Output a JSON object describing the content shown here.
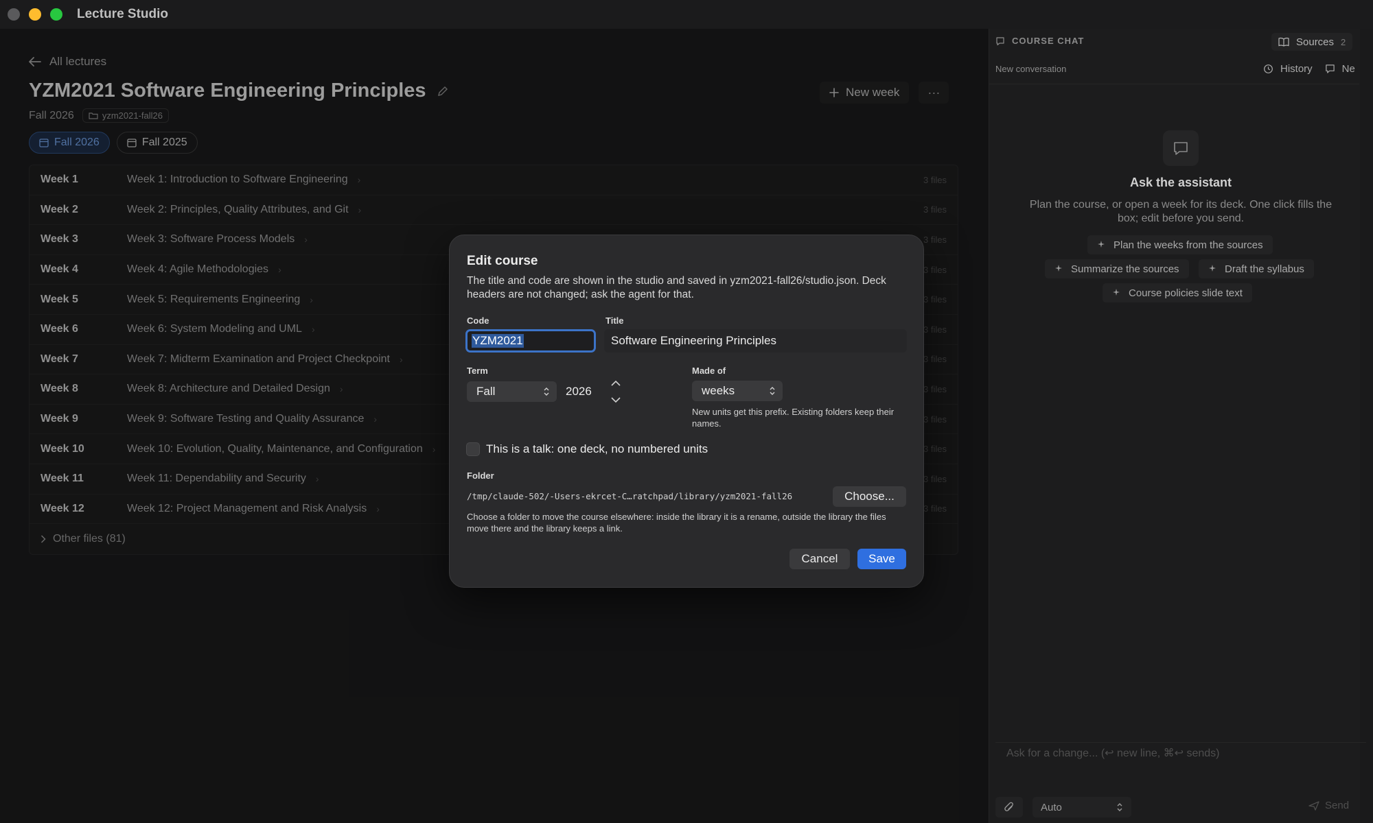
{
  "app": {
    "title": "Lecture Studio"
  },
  "window_controls": {
    "close_color": "#ff5f57",
    "minimize_color": "#febc2e",
    "zoom_color": "#28c840"
  },
  "header": {
    "back_label": "All lectures",
    "course_title": "YZM2021 Software Engineering Principles",
    "term": "Fall 2026",
    "folder": "yzm2021-fall26",
    "new_week_label": "New week",
    "more_label": "···"
  },
  "term_tabs": [
    {
      "label": "Fall 2026",
      "active": true
    },
    {
      "label": "Fall 2025",
      "active": false
    }
  ],
  "weeks": [
    {
      "num": "Week 1",
      "title": "Week 1: Introduction to Software Engineering",
      "files": "3 files"
    },
    {
      "num": "Week 2",
      "title": "Week 2: Principles, Quality Attributes, and Git",
      "files": "3 files"
    },
    {
      "num": "Week 3",
      "title": "Week 3: Software Process Models",
      "files": "3 files"
    },
    {
      "num": "Week 4",
      "title": "Week 4: Agile Methodologies",
      "files": "3 files"
    },
    {
      "num": "Week 5",
      "title": "Week 5: Requirements Engineering",
      "files": "3 files"
    },
    {
      "num": "Week 6",
      "title": "Week 6: System Modeling and UML",
      "files": "3 files"
    },
    {
      "num": "Week 7",
      "title": "Week 7: Midterm Examination and Project Checkpoint",
      "files": "3 files"
    },
    {
      "num": "Week 8",
      "title": "Week 8: Architecture and Detailed Design",
      "files": "3 files"
    },
    {
      "num": "Week 9",
      "title": "Week 9: Software Testing and Quality Assurance",
      "files": "3 files"
    },
    {
      "num": "Week 10",
      "title": "Week 10: Evolution, Quality, Maintenance, and Configuration",
      "files": "3 files"
    },
    {
      "num": "Week 11",
      "title": "Week 11: Dependability and Security",
      "files": "3 files"
    },
    {
      "num": "Week 12",
      "title": "Week 12: Project Management and Risk Analysis",
      "files": "3 files"
    }
  ],
  "other_files": "Other files (81)",
  "chat": {
    "header": "COURSE CHAT",
    "sources_label": "Sources",
    "sources_count": "2",
    "new_conversation": "New conversation",
    "history_label": "History",
    "new_label": "Ne",
    "assistant_title": "Ask the assistant",
    "assistant_desc": "Plan the course, or open a week for its deck. One click fills the box; edit before you send.",
    "suggestions": [
      "Plan the weeks from the sources",
      "Summarize the sources",
      "Draft the syllabus",
      "Course policies slide text"
    ],
    "input_placeholder": "Ask for a change... (↩ new line, ⌘↩ sends)",
    "model": "Auto",
    "send_label": "Send"
  },
  "modal": {
    "title": "Edit course",
    "description": "The title and code are shown in the studio and saved in yzm2021-fall26/studio.json. Deck headers are not changed; ask the agent for that.",
    "code_label": "Code",
    "code_value": "YZM2021",
    "title_label": "Title",
    "title_value": "Software Engineering Principles",
    "term_label": "Term",
    "term_value": "Fall",
    "year_value": "2026",
    "made_of_label": "Made of",
    "made_of_value": "weeks",
    "made_of_hint": "New units get this prefix. Existing folders keep their names.",
    "talk_checkbox_label": "This is a talk: one deck, no numbered units",
    "talk_checked": false,
    "folder_label": "Folder",
    "folder_path": "/tmp/claude-502/-Users-ekrcet-C…ratchpad/library/yzm2021-fall26",
    "choose_label": "Choose...",
    "folder_hint": "Choose a folder to move the course elsewhere: inside the library it is a rename, outside the library the files move there and the library keeps a link.",
    "cancel_label": "Cancel",
    "save_label": "Save"
  },
  "colors": {
    "accent": "#2f6fe0",
    "focus_ring": "#3c73c8",
    "active_tab": "#6f9de0"
  }
}
